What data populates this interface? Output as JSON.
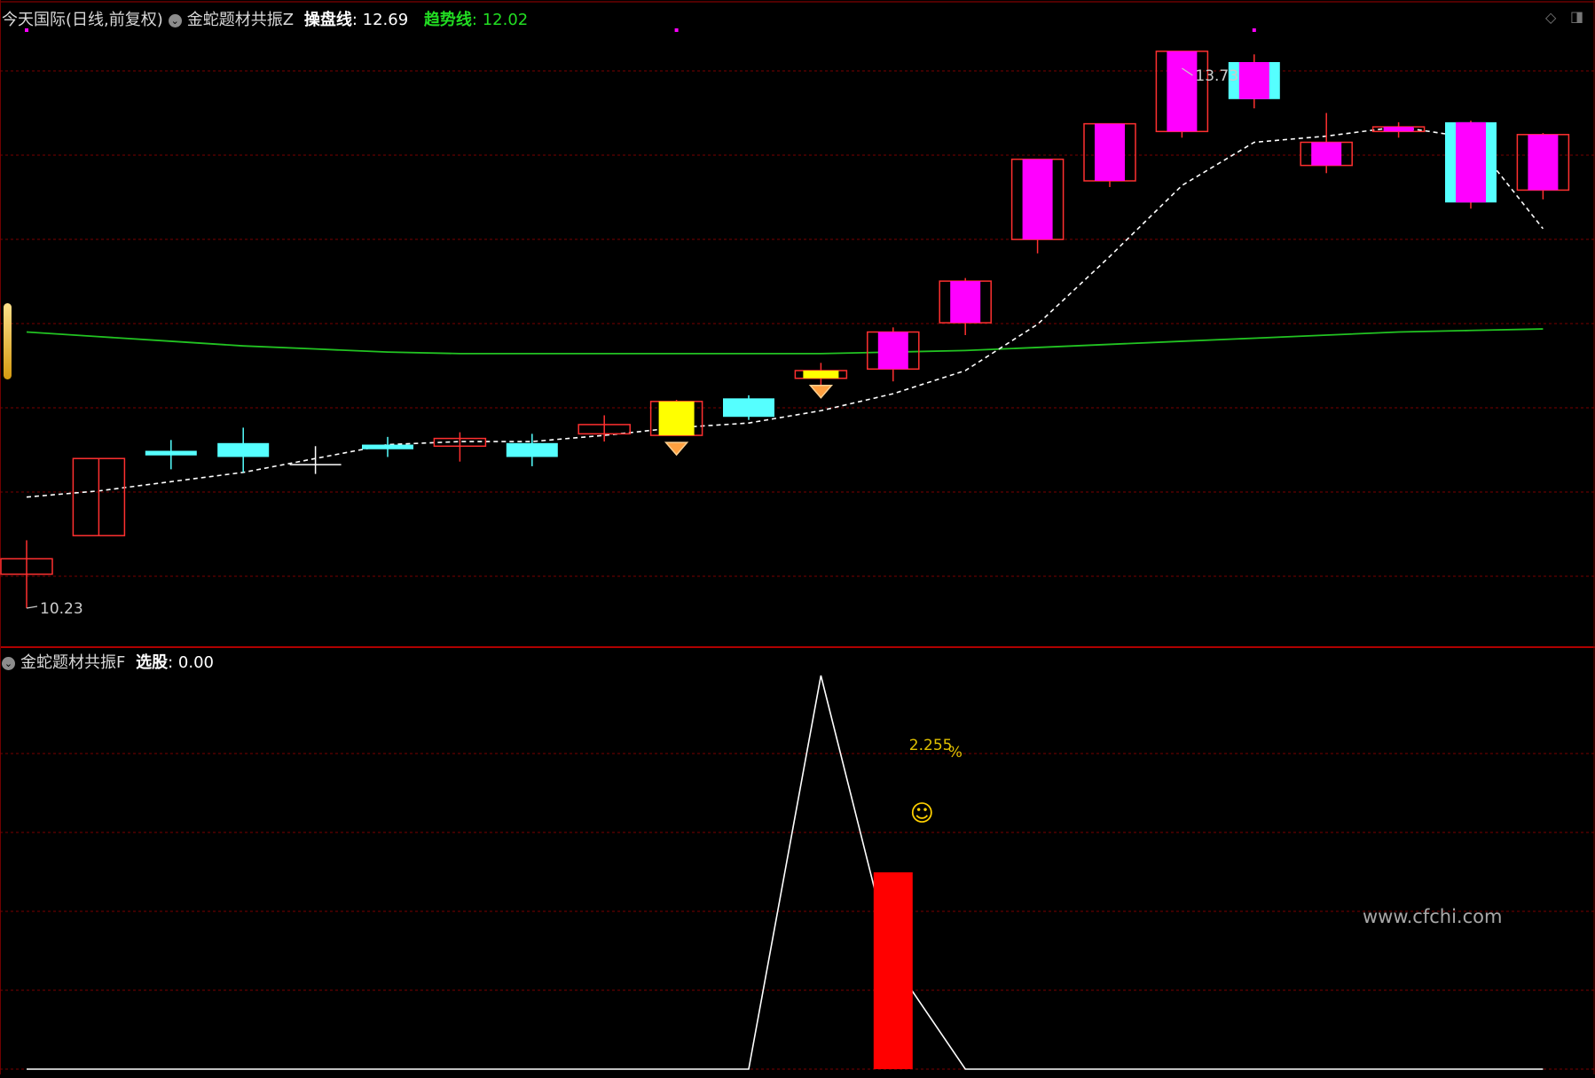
{
  "main_panel": {
    "stock_label": "今天国际(日线,前复权)",
    "indicator_name": "金蛇题材共振Z",
    "line1_label": "操盘线",
    "line1_value": "12.69",
    "line2_label": "趋势线",
    "line2_value": "12.02",
    "high_label": "13.73",
    "low_label": "10.23"
  },
  "sub_panel": {
    "indicator_name": "金蛇题材共振F",
    "value_label": "选股",
    "value": "0.00",
    "pct_label": "2.255",
    "pct_symbol": "%",
    "smiley": "☺"
  },
  "watermark": "www.cfchi.com",
  "colors": {
    "background": "#000000",
    "up_outline": "#ff3030",
    "magenta": "#ff00ff",
    "cyan": "#55ffff",
    "yellow": "#ffff00",
    "trend_green": "#22c322",
    "white_line": "#ffffff",
    "grid": "#7a0000",
    "red_bar": "#ff0000",
    "label_gold": "#e0c000",
    "label_green": "#22dd22"
  },
  "chart_data": [
    {
      "type": "candlestick",
      "panel": "main",
      "ylim": [
        10.0,
        14.0
      ],
      "candles": [
        {
          "open": 10.45,
          "high": 10.67,
          "low": 10.23,
          "close": 10.55,
          "style": "up"
        },
        {
          "open": 10.7,
          "high": 11.2,
          "low": 10.7,
          "close": 11.2,
          "style": "up"
        },
        {
          "open": 11.25,
          "high": 11.32,
          "low": 11.13,
          "close": 11.22,
          "style": "cyan"
        },
        {
          "open": 11.3,
          "high": 11.4,
          "low": 11.11,
          "close": 11.21,
          "style": "cyan"
        },
        {
          "open": 11.16,
          "high": 11.28,
          "low": 11.1,
          "close": 11.16,
          "style": "doji"
        },
        {
          "open": 11.29,
          "high": 11.34,
          "low": 11.21,
          "close": 11.26,
          "style": "cyan"
        },
        {
          "open": 11.33,
          "high": 11.37,
          "low": 11.18,
          "close": 11.28,
          "style": "up"
        },
        {
          "open": 11.3,
          "high": 11.36,
          "low": 11.15,
          "close": 11.21,
          "style": "cyan"
        },
        {
          "open": 11.36,
          "high": 11.48,
          "low": 11.31,
          "close": 11.42,
          "style": "up"
        },
        {
          "open": 11.35,
          "high": 11.58,
          "low": 11.35,
          "close": 11.57,
          "style": "yellow"
        },
        {
          "open": 11.59,
          "high": 11.61,
          "low": 11.45,
          "close": 11.47,
          "style": "cyan"
        },
        {
          "open": 11.77,
          "high": 11.82,
          "low": 11.63,
          "close": 11.72,
          "style": "yellow"
        },
        {
          "open": 11.78,
          "high": 12.05,
          "low": 11.7,
          "close": 12.02,
          "style": "magenta"
        },
        {
          "open": 12.08,
          "high": 12.37,
          "low": 12.0,
          "close": 12.35,
          "style": "magenta"
        },
        {
          "open": 12.62,
          "high": 12.78,
          "low": 12.53,
          "close": 13.14,
          "style": "magenta"
        },
        {
          "open": 13.0,
          "high": 13.23,
          "low": 12.96,
          "close": 13.37,
          "style": "magenta"
        },
        {
          "open": 13.32,
          "high": 13.73,
          "low": 13.28,
          "close": 13.84,
          "style": "magenta"
        },
        {
          "open": 13.53,
          "high": 13.82,
          "low": 13.47,
          "close": 13.77,
          "style": "magenta_cyan"
        },
        {
          "open": 13.1,
          "high": 13.44,
          "low": 13.05,
          "close": 13.25,
          "style": "magenta"
        },
        {
          "open": 13.32,
          "high": 13.38,
          "low": 13.28,
          "close": 13.35,
          "style": "magenta"
        },
        {
          "open": 12.86,
          "high": 13.39,
          "low": 12.82,
          "close": 13.38,
          "style": "magenta_cyan"
        },
        {
          "open": 12.94,
          "high": 13.31,
          "low": 12.88,
          "close": 13.3,
          "style": "magenta"
        }
      ],
      "series": [
        {
          "name": "操盘线",
          "style": "dashed-white",
          "values": [
            10.95,
            10.99,
            11.05,
            11.11,
            11.2,
            11.29,
            11.31,
            11.31,
            11.35,
            11.4,
            11.43,
            11.51,
            11.62,
            11.77,
            12.07,
            12.51,
            12.97,
            13.25,
            13.29,
            13.35,
            13.28,
            12.69
          ]
        },
        {
          "name": "趋势线",
          "style": "green",
          "values": [
            12.02,
            11.99,
            11.96,
            11.93,
            11.91,
            11.89,
            11.88,
            11.88,
            11.88,
            11.88,
            11.88,
            11.88,
            11.89,
            11.9,
            11.92,
            11.94,
            11.96,
            11.98,
            12.0,
            12.02,
            12.03,
            12.04
          ]
        }
      ],
      "markers": [
        {
          "index": 9,
          "type": "diamond"
        },
        {
          "index": 11,
          "type": "diamond"
        },
        {
          "index": 0,
          "type": "magenta-dot",
          "position": "top"
        },
        {
          "index": 9,
          "type": "magenta-dot",
          "position": "top"
        },
        {
          "index": 17,
          "type": "magenta-dot",
          "position": "top"
        }
      ],
      "annotations": [
        {
          "text": "13.73",
          "index": 16,
          "value": 13.73
        },
        {
          "text": "10.23",
          "index": 0,
          "value": 10.23
        }
      ]
    },
    {
      "type": "line",
      "panel": "sub",
      "ylim": [
        0,
        1
      ],
      "series": [
        {
          "name": "选股",
          "values": [
            0,
            0,
            0,
            0,
            0,
            0,
            0,
            0,
            0,
            0,
            0,
            1,
            0.27,
            0,
            0,
            0,
            0,
            0,
            0,
            0,
            0,
            0
          ]
        }
      ],
      "bars": [
        {
          "index": 12,
          "value": 0.5
        }
      ],
      "annotations": [
        {
          "text": "2.255",
          "suffix": "%",
          "index": 12
        },
        {
          "type": "smiley",
          "index": 12
        }
      ]
    }
  ]
}
